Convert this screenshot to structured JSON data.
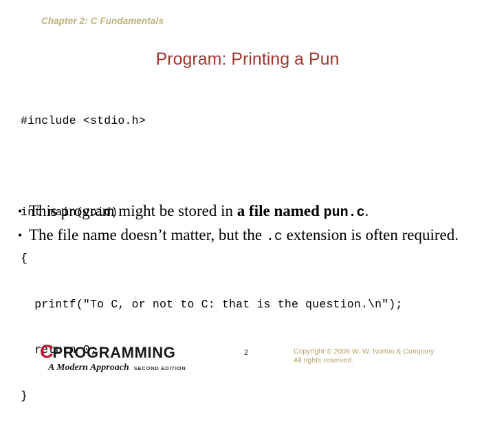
{
  "slide": {
    "chapter_header": "Chapter 2: C Fundamentals",
    "title": "Program: Printing a Pun",
    "colors": {
      "chapter_header": "#bdb076",
      "title": "#9e3830",
      "code": "#000000",
      "body": "#000000",
      "logo_c": "#c8102e",
      "logo_word": "#1a1a1a",
      "copyright": "#b3a369"
    }
  },
  "code": {
    "lines": [
      "#include <stdio.h>",
      "",
      "int main(void)",
      "{",
      "  printf(\"To C, or not to C: that is the question.\\n\");",
      "  return 0;",
      "}"
    ]
  },
  "bullets": [
    {
      "marker": "•",
      "segments": [
        {
          "text": "This program might be stored in ",
          "style": "normal"
        },
        {
          "text": "a file named ",
          "style": "bold"
        },
        {
          "text": "pun.c",
          "style": "mono-bold"
        },
        {
          "text": ".",
          "style": "normal"
        }
      ]
    },
    {
      "marker": "•",
      "segments": [
        {
          "text": "The file name doesn’t matter, but the ",
          "style": "normal"
        },
        {
          "text": ".c",
          "style": "mono"
        },
        {
          "text": " extension is often required.",
          "style": "normal"
        }
      ]
    }
  ],
  "footer": {
    "logo": {
      "letter": "C",
      "word": "PROGRAMMING",
      "tagline": "A Modern Approach",
      "edition": "SECOND EDITION"
    },
    "page_number": "2",
    "copyright_line1": "Copyright © 2008 W. W. Norton & Company.",
    "copyright_line2": "All rights reserved."
  }
}
